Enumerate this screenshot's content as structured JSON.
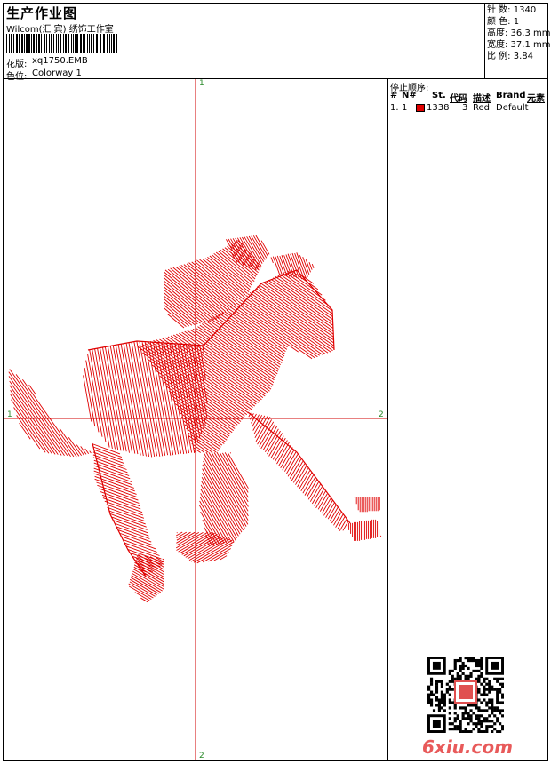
{
  "header": {
    "title": "生产作业图",
    "company": "Wilcom(汇 宾) 绣饰工作室",
    "design_label": "花版:",
    "design_value": "xq1750.EMB",
    "colorway_label": "色位:",
    "colorway_value": "Colorway 1"
  },
  "stats": {
    "stitches": "针 数: 1340",
    "colors": "颜 色: 1",
    "height": "高度: 36.3 mm",
    "width": "宽度: 37.1 mm",
    "ratio": "比 例: 3.84"
  },
  "stop_sequence": {
    "title": "停止顺序:",
    "columns": [
      "#",
      "N#",
      "St.",
      "代码",
      "描述",
      "Brand",
      "元素"
    ],
    "rows": [
      {
        "idx": "1.",
        "needle": "1",
        "color": "#e00000",
        "stitches": "1338",
        "code": "3",
        "desc": "Red",
        "brand": "Default"
      }
    ]
  },
  "axes": {
    "top": "1",
    "bottom": "2",
    "left": "1",
    "right": "2"
  },
  "colors": {
    "thread": "#e00000",
    "axis_line": "#d00000"
  },
  "watermark": "6xiu.com"
}
